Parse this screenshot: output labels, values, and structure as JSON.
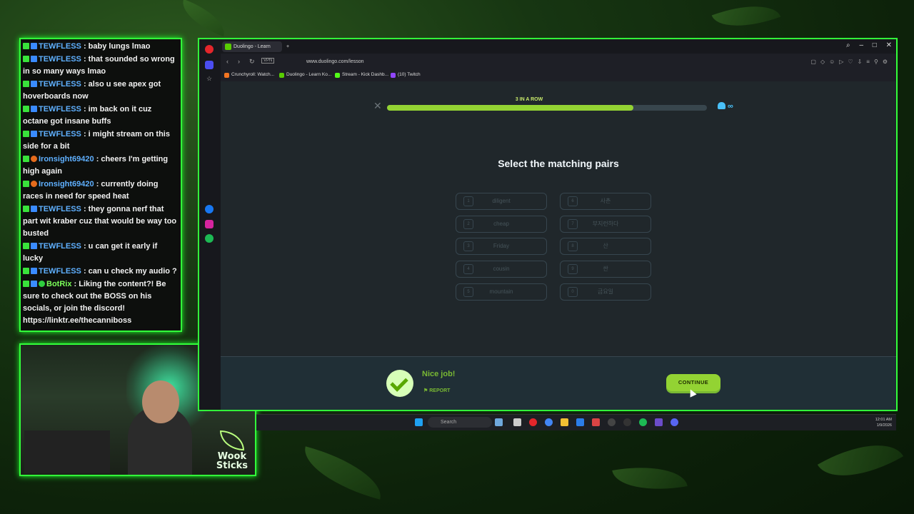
{
  "chat": {
    "messages": [
      {
        "user": "TEWFLESS",
        "text": ": baby lungs lmao",
        "badges": [
          "kick",
          "blue"
        ]
      },
      {
        "user": "TEWFLESS",
        "text": ": that sounded so wrong in so many ways lmao",
        "badges": [
          "kick",
          "blue"
        ]
      },
      {
        "user": "TEWFLESS",
        "text": ": also u see apex got hoverboards now",
        "badges": [
          "kick",
          "blue"
        ]
      },
      {
        "user": "TEWFLESS",
        "text": ": im back on it cuz octane got insane buffs",
        "badges": [
          "kick",
          "blue"
        ]
      },
      {
        "user": "TEWFLESS",
        "text": ": i might stream on this side for a bit",
        "badges": [
          "kick",
          "blue"
        ]
      },
      {
        "user": "Ironsight69420",
        "text": ": cheers I'm getting high again",
        "badges": [
          "kick",
          "orange"
        ]
      },
      {
        "user": "Ironsight69420",
        "text": ": currently doing races in need for speed heat",
        "badges": [
          "kick",
          "orange"
        ]
      },
      {
        "user": "TEWFLESS",
        "text": ": they gonna nerf that part wit kraber cuz that would be way too busted",
        "badges": [
          "kick",
          "blue"
        ]
      },
      {
        "user": "TEWFLESS",
        "text": ": u can get it early if lucky",
        "badges": [
          "kick",
          "blue"
        ]
      },
      {
        "user": "TEWFLESS",
        "text": ": can u check my audio ?",
        "badges": [
          "kick",
          "blue"
        ]
      },
      {
        "user": "BotRix",
        "text": ": Liking the content?! Be sure to check out the BOSS on his socials, or join the discord! https://linktr.ee/thecanniboss",
        "badges": [
          "kick",
          "blue",
          "green"
        ],
        "bot": true
      }
    ]
  },
  "webcam": {
    "logo_text_1": "Wook",
    "logo_text_2": "Sticks"
  },
  "browser": {
    "active_tab": "Duolingo - Learn Ko...",
    "url": "www.duolingo.com/lesson",
    "bookmarks": [
      {
        "label": "Crunchyroll: Watch...",
        "color": "#f47521"
      },
      {
        "label": "Duolingo - Learn Ko...",
        "color": "#58cc02"
      },
      {
        "label": "Stream - Kick Dashb...",
        "color": "#53fc18"
      },
      {
        "label": "(10) Twitch",
        "color": "#9146ff"
      }
    ]
  },
  "lesson": {
    "streak_label": "3 IN A ROW",
    "progress": 0.77,
    "hearts": "∞",
    "title": "Select the matching pairs",
    "left_pairs": [
      {
        "num": "1",
        "word": "diligent"
      },
      {
        "num": "2",
        "word": "cheap"
      },
      {
        "num": "3",
        "word": "Friday"
      },
      {
        "num": "4",
        "word": "cousin"
      },
      {
        "num": "5",
        "word": "mountain"
      }
    ],
    "right_pairs": [
      {
        "num": "6",
        "word": "사촌"
      },
      {
        "num": "7",
        "word": "부지런하다"
      },
      {
        "num": "8",
        "word": "산"
      },
      {
        "num": "9",
        "word": "싼"
      },
      {
        "num": "0",
        "word": "금요일"
      }
    ],
    "feedback_title": "Nice job!",
    "report_label": "REPORT",
    "continue_label": "CONTINUE"
  },
  "taskbar": {
    "search_placeholder": "Search",
    "time": "12:01 AM",
    "date": "1/9/2026"
  },
  "colors": {
    "accent_green": "#32ff3a",
    "duo_green": "#93d333",
    "page_bg": "#20272b"
  }
}
